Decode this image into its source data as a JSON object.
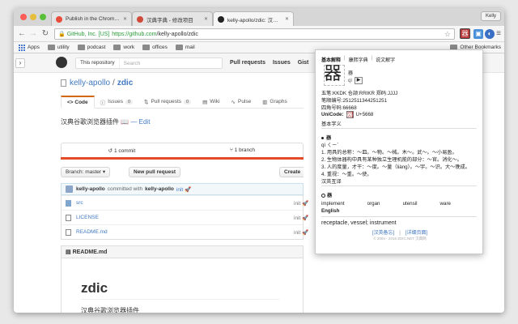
{
  "browser": {
    "tabs": [
      {
        "label": "Publish in the Chrome Web",
        "fav_color": "#e74c3c"
      },
      {
        "label": "汉典字典 - 修改项目",
        "fav_color": "#d04a3a"
      },
      {
        "label": "kelly-apollo/zdic: 汉典谷歌",
        "fav_color": "#222222"
      }
    ],
    "user": "Kelly",
    "address": {
      "ev_label": "GitHub, Inc. [US]",
      "url_scheme": "https://github.com",
      "url_path": "/kelly-apollo/zdic"
    },
    "extension_colors": {
      "zdic": "#b83a3a",
      "ext2": "#4a90d9",
      "ext3": "#3a6fc6"
    },
    "bookmarks": [
      {
        "label": "Apps"
      },
      {
        "label": "utility"
      },
      {
        "label": "podcast"
      },
      {
        "label": "work"
      },
      {
        "label": "offices"
      },
      {
        "label": "mail"
      }
    ],
    "bookmarks_other": "Other Bookmarks"
  },
  "github": {
    "search_scope": "This repository",
    "search_placeholder": "Search",
    "nav": [
      "Pull requests",
      "Issues",
      "Gist"
    ],
    "owner": "kelly-apollo",
    "separator": "/",
    "repo": "zdic",
    "tabs": [
      {
        "label": "<> Code",
        "count": ""
      },
      {
        "label": "Issues",
        "count": "0"
      },
      {
        "label": "Pull requests",
        "count": "0"
      },
      {
        "label": "Wiki",
        "count": ""
      },
      {
        "label": "Pulse",
        "count": ""
      },
      {
        "label": "Graphs",
        "count": ""
      }
    ],
    "description": "汉典谷歌浏览器插件 📖",
    "edit_label": "— Edit",
    "numbers": [
      {
        "label": "1 commit"
      },
      {
        "label": "1 branch"
      }
    ],
    "lang_color": "#e34c26",
    "branch_button": "Branch: master ▾",
    "new_pr_button": "New pull request",
    "create_button": "Create",
    "commit": {
      "author": "kelly-apollo",
      "message": "committed with",
      "committer": "kelly-apollo",
      "text": "init 🚀"
    },
    "files": [
      {
        "name": "src",
        "type": "dir",
        "message": "init 🚀"
      },
      {
        "name": "LICENSE",
        "type": "doc",
        "message": "init 🚀"
      },
      {
        "name": "README.md",
        "type": "doc",
        "message": "init 🚀"
      }
    ],
    "readme_title": "README.md",
    "readme_h1": "zdic",
    "readme_p": "汉典谷歌浏览器插件"
  },
  "popup": {
    "tabs": [
      "基本解释",
      "康熙字典",
      "说文解字"
    ],
    "character": "器",
    "pinyin_top": "器",
    "pinyin_sub": "qì",
    "lines": [
      "五笔:KKDK     仓颉:RRIKR   郑码:JJJJ",
      "笔顺编号:2512511344251251",
      "四角号码:66668",
      "基本字义"
    ],
    "unicode_label": "UniCode:",
    "unicode_value": "U+5668",
    "definition_head": "器",
    "definition_pinyin": "qì ㄑㄧˋ",
    "definitions": [
      "1. 用具的总称：～皿。～物。～械。木～。武～。～小易盈。",
      "2. 生物体器构中具有某种独立生理机能的部分：～官。消化～。",
      "3. 人的度量，才干：～度。～量（liàng）。～宇。～识。大～晚成。",
      "4. 重视：～重。～使。",
      "汉英互译"
    ],
    "english_head": "器",
    "english_words": [
      "implement",
      "organ",
      "utensil",
      "ware"
    ],
    "english_label": "English",
    "english_def": "receptacle, vessel; instrument",
    "links": [
      "[汉英备忘]",
      "[详细页面]"
    ],
    "copyright": "© 2004 - 2016 ZDIC.NET 汉典网"
  }
}
